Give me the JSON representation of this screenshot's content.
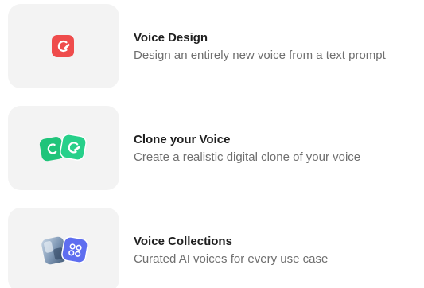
{
  "options": [
    {
      "title": "Voice Design",
      "description": "Design an entirely new voice from a text prompt",
      "icon": "voice-design-icon",
      "icon_color": "#ef4c4c"
    },
    {
      "title": "Clone your Voice",
      "description": "Create a realistic digital clone of your voice",
      "icon": "voice-clone-icon",
      "icon_color": "#1fc47a"
    },
    {
      "title": "Voice Collections",
      "description": "Curated AI voices for every use case",
      "icon": "voice-collections-icon",
      "icon_color": "#5e6ef0"
    }
  ]
}
